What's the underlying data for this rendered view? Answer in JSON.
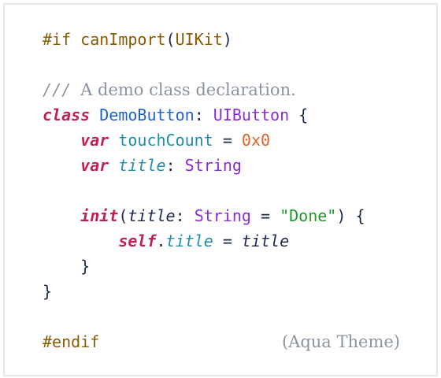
{
  "code": {
    "line1": {
      "directive": "#if",
      "func": "canImport",
      "open": "(",
      "arg": "UIKit",
      "close": ")"
    },
    "line3": {
      "slashes": "///",
      "comment": "A demo class declaration."
    },
    "line4": {
      "keyword": "class",
      "name": "DemoButton",
      "colon": ":",
      "super": "UIButton",
      "brace": "{"
    },
    "line5": {
      "keyword": "var",
      "name": "touchCount",
      "eq": "=",
      "value": "0x0"
    },
    "line6": {
      "keyword": "var",
      "name": "title",
      "colon": ":",
      "type": "String"
    },
    "line8": {
      "keyword": "init",
      "open": "(",
      "param": "title",
      "colon": ":",
      "type": "String",
      "eq": "=",
      "default": "\"Done\"",
      "close": ")",
      "brace": "{"
    },
    "line9": {
      "self": "self",
      "dot": ".",
      "prop": "title",
      "eq": "=",
      "value": "title"
    },
    "line10": {
      "brace": "}"
    },
    "line11": {
      "brace": "}"
    },
    "line13": {
      "directive": "#endif"
    }
  },
  "theme_label": "(Aqua Theme)",
  "colors": {
    "keyword": "#c41e5a",
    "macro": "#8a5a00",
    "type": "#8a2bd6",
    "identifier": "#1f63c6",
    "property": "#1f8ea8",
    "number": "#e0602a",
    "string": "#1f9a2a",
    "comment": "#8a94a0",
    "plain": "#1c2a4a"
  }
}
